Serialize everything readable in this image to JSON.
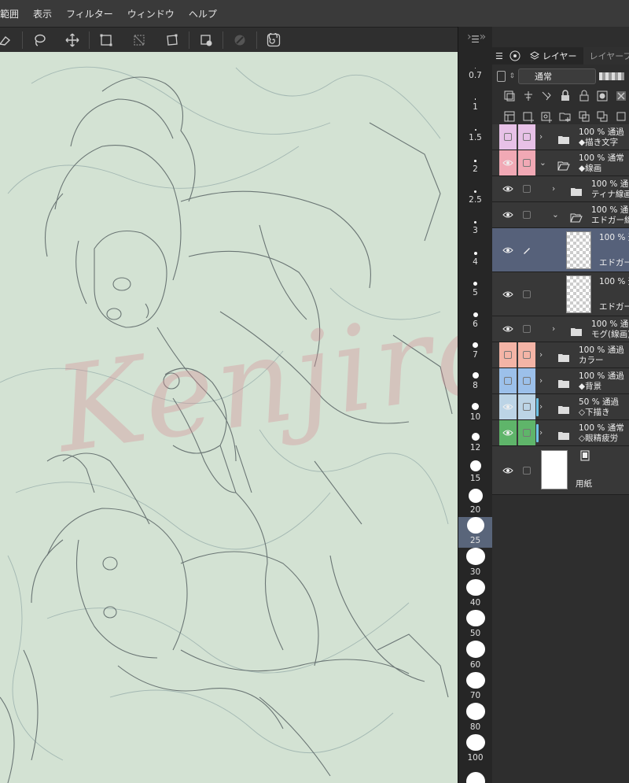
{
  "menu": [
    "範囲",
    "表示",
    "フィルター",
    "ウィンドウ",
    "ヘルプ"
  ],
  "toolbar": [
    "eraser-icon",
    "lasso-icon",
    "move-icon",
    "select-transform-icon",
    "deselect-icon",
    "transform-icon",
    "paint-bucket-icon",
    "clear-icon",
    "spiral-icon"
  ],
  "canvas": {
    "watermark": "Kenjiro"
  },
  "brush_sizes": [
    {
      "label": "0.7",
      "d": 1
    },
    {
      "label": "1",
      "d": 1.5
    },
    {
      "label": "1.5",
      "d": 2
    },
    {
      "label": "2",
      "d": 2.5
    },
    {
      "label": "2.5",
      "d": 3
    },
    {
      "label": "3",
      "d": 3.5
    },
    {
      "label": "4",
      "d": 4
    },
    {
      "label": "5",
      "d": 5
    },
    {
      "label": "6",
      "d": 6
    },
    {
      "label": "7",
      "d": 7
    },
    {
      "label": "8",
      "d": 8
    },
    {
      "label": "10",
      "d": 9
    },
    {
      "label": "12",
      "d": 10
    },
    {
      "label": "15",
      "d": 14
    },
    {
      "label": "20",
      "d": 18
    },
    {
      "label": "25",
      "d": 22,
      "selected": true
    },
    {
      "label": "30",
      "d": 24
    },
    {
      "label": "40",
      "d": 24
    },
    {
      "label": "50",
      "d": 24
    },
    {
      "label": "60",
      "d": 24
    },
    {
      "label": "70",
      "d": 24
    },
    {
      "label": "80",
      "d": 24
    },
    {
      "label": "100",
      "d": 24
    },
    {
      "label": "",
      "d": 24
    }
  ],
  "layer_panel": {
    "tab_active": "レイヤー",
    "tab_inactive": "レイヤープ",
    "blend_mode": "通常",
    "layers": [
      {
        "name": "◆描き文字",
        "info": "100 % 通過",
        "type": "folder",
        "indent": 0,
        "color": "#e7c1e7",
        "visible": false
      },
      {
        "name": "◆線画",
        "info": "100 % 通常",
        "type": "folder-open",
        "indent": 0,
        "color": "#f1a9b5",
        "visible": true
      },
      {
        "name": "ティナ線画",
        "info": "100 % 通常",
        "type": "folder",
        "indent": 1,
        "visible": true
      },
      {
        "name": "エドガー線",
        "info": "100 % 通常",
        "type": "folder-open",
        "indent": 1,
        "visible": true
      },
      {
        "name": "エドガー",
        "info": "100 % 通",
        "type": "raster",
        "indent": 2,
        "visible": true,
        "selected": true
      },
      {
        "name": "エドガー",
        "info": "100 % 通",
        "type": "raster",
        "indent": 2,
        "visible": true
      },
      {
        "name": "モグ(線画)",
        "info": "100 % 通常",
        "type": "folder",
        "indent": 1,
        "visible": true
      },
      {
        "name": "カラー",
        "info": "100 % 通過",
        "type": "folder",
        "indent": 0,
        "color": "#f4b4a6",
        "visible": false
      },
      {
        "name": "◆背景",
        "info": "100 % 通過",
        "type": "folder",
        "indent": 0,
        "color": "#9cc0ea",
        "visible": false
      },
      {
        "name": "◇下描き",
        "info": "50 % 通過",
        "type": "folder",
        "indent": 0,
        "color": "#bcd4e6",
        "visible": true,
        "bluebar": true
      },
      {
        "name": "◇眼精疲労",
        "info": "100 % 通常",
        "type": "folder",
        "indent": 0,
        "color": "#5fb56a",
        "visible": true,
        "bluebar": true
      },
      {
        "name": "用紙",
        "info": "",
        "type": "paper",
        "indent": 0,
        "visible": true
      }
    ]
  }
}
